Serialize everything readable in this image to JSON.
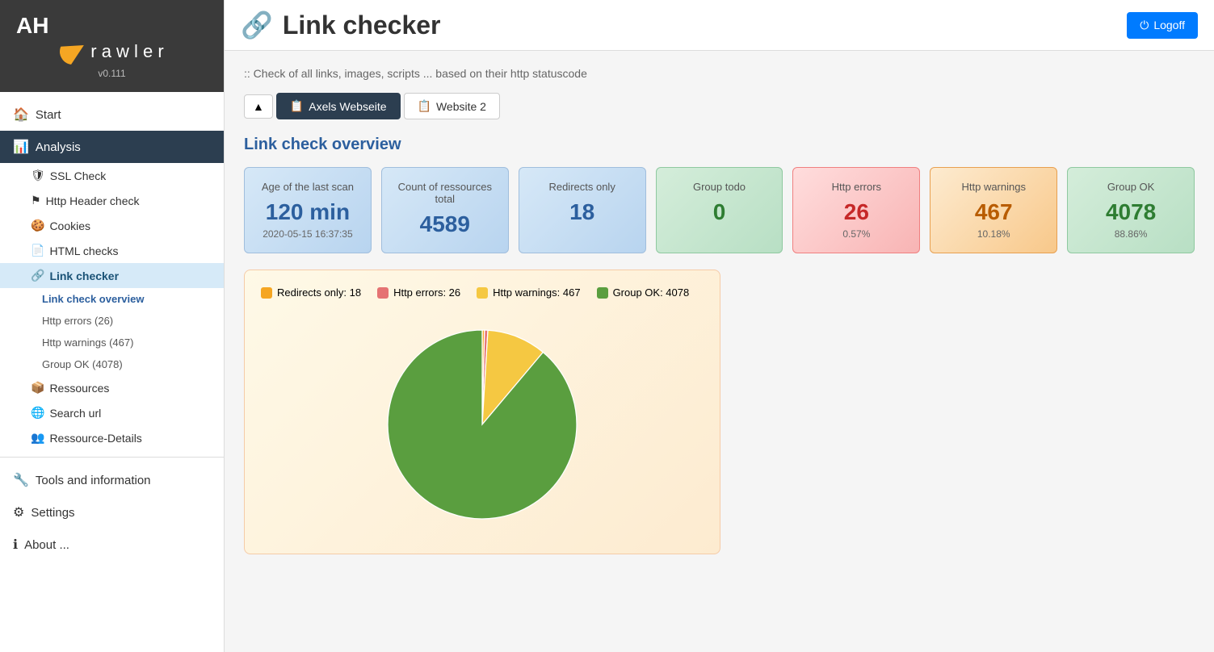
{
  "app": {
    "name": "AH",
    "subname": "r a w l e r",
    "version": "v0.111"
  },
  "header": {
    "icon": "🔗",
    "title": "Link checker",
    "subtitle": ":: Check of all links, images, scripts ... based on their http statuscode",
    "logoff_label": "Logoff"
  },
  "sidebar": {
    "items": [
      {
        "id": "start",
        "label": "Start",
        "icon": "🏠",
        "active": false
      },
      {
        "id": "analysis",
        "label": "Analysis",
        "icon": "📊",
        "active": true
      },
      {
        "id": "ssl-check",
        "label": "SSL Check",
        "icon": "🛡",
        "active": false,
        "indent": 1
      },
      {
        "id": "http-header-check",
        "label": "Http Header check",
        "icon": "⚑",
        "active": false,
        "indent": 1
      },
      {
        "id": "cookies",
        "label": "Cookies",
        "icon": "🍪",
        "active": false,
        "indent": 1
      },
      {
        "id": "html-checks",
        "label": "HTML checks",
        "icon": "📄",
        "active": false,
        "indent": 1
      },
      {
        "id": "link-checker",
        "label": "Link checker",
        "icon": "🔗",
        "active": true,
        "indent": 1
      },
      {
        "id": "link-check-overview",
        "label": "Link check overview",
        "active": true,
        "indent": 2
      },
      {
        "id": "http-errors",
        "label": "Http errors (26)",
        "active": false,
        "indent": 3
      },
      {
        "id": "http-warnings",
        "label": "Http warnings (467)",
        "active": false,
        "indent": 3
      },
      {
        "id": "group-ok",
        "label": "Group OK (4078)",
        "active": false,
        "indent": 3
      },
      {
        "id": "resources",
        "label": "Ressources",
        "icon": "📦",
        "active": false,
        "indent": 1
      },
      {
        "id": "search-url",
        "label": "Search url",
        "icon": "🌐",
        "active": false,
        "indent": 1
      },
      {
        "id": "resource-details",
        "label": "Ressource-Details",
        "icon": "👥",
        "active": false,
        "indent": 1
      }
    ],
    "bottom_items": [
      {
        "id": "tools",
        "label": "Tools and information",
        "icon": "🔧",
        "active": false
      },
      {
        "id": "settings",
        "label": "Settings",
        "icon": "⚙",
        "active": false
      },
      {
        "id": "about",
        "label": "About ...",
        "icon": "ℹ",
        "active": false
      }
    ]
  },
  "tabs": {
    "up_button": "▲",
    "items": [
      {
        "id": "axels-webseite",
        "label": "Axels Webseite",
        "icon": "📋",
        "active": true
      },
      {
        "id": "website-2",
        "label": "Website 2",
        "icon": "📋",
        "active": false
      }
    ]
  },
  "overview": {
    "title": "Link check overview",
    "stats": [
      {
        "id": "last-scan",
        "label": "Age of the last scan",
        "value": "120 min",
        "sub": "2020-05-15 16:37:35",
        "color": "blue"
      },
      {
        "id": "total",
        "label": "Count of ressources total",
        "value": "4589",
        "sub": "",
        "color": "blue"
      },
      {
        "id": "redirects",
        "label": "Redirects only",
        "value": "18",
        "sub": "",
        "color": "blue"
      },
      {
        "id": "group-todo",
        "label": "Group todo",
        "value": "0",
        "sub": "",
        "color": "green"
      },
      {
        "id": "http-errors",
        "label": "Http errors",
        "value": "26",
        "sub": "0.57%",
        "color": "red"
      },
      {
        "id": "http-warnings",
        "label": "Http warnings",
        "value": "467",
        "sub": "10.18%",
        "color": "orange"
      },
      {
        "id": "group-ok",
        "label": "Group OK",
        "value": "4078",
        "sub": "88.86%",
        "color": "green"
      }
    ]
  },
  "chart": {
    "legend": [
      {
        "id": "redirects",
        "label": "Redirects only: 18",
        "color": "redirects"
      },
      {
        "id": "errors",
        "label": "Http errors: 26",
        "color": "errors"
      },
      {
        "id": "warnings",
        "label": "Http warnings: 467",
        "color": "warnings"
      },
      {
        "id": "ok",
        "label": "Group OK: 4078",
        "color": "ok"
      }
    ],
    "data": {
      "redirects": 18,
      "errors": 26,
      "warnings": 467,
      "ok": 4078,
      "total": 4589
    }
  }
}
